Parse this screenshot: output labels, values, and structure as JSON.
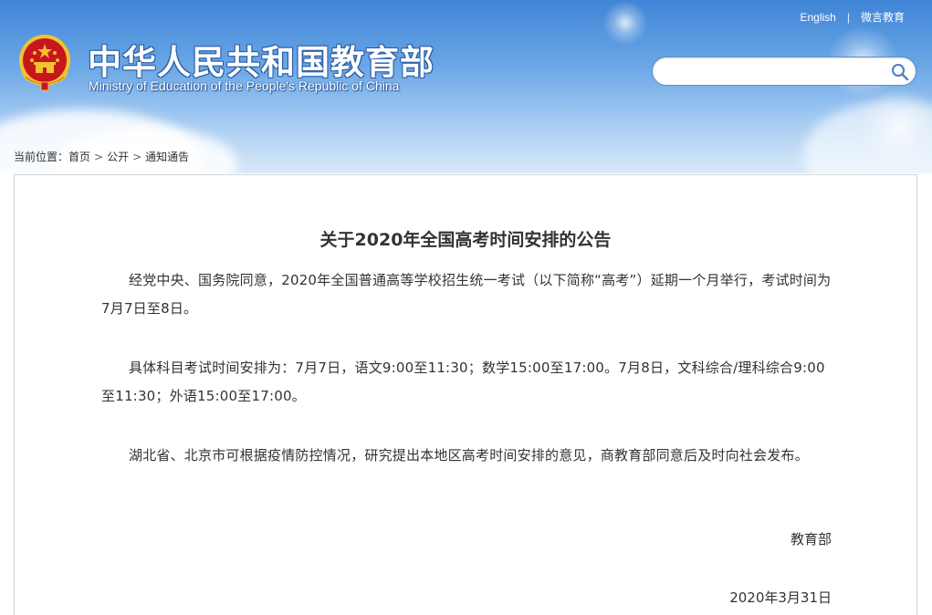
{
  "header": {
    "title": "中华人民共和国教育部",
    "subtitle": "Ministry of Education of the People's Republic of China",
    "links": [
      {
        "label": "English"
      },
      {
        "label": "微言教育"
      }
    ],
    "link_separator": "|",
    "search": {
      "value": "",
      "placeholder": ""
    }
  },
  "breadcrumb": {
    "prefix": "当前位置：",
    "items": [
      "首页",
      "公开",
      "通知通告"
    ],
    "separator": ">"
  },
  "article": {
    "title": "关于2020年全国高考时间安排的公告",
    "paragraphs": [
      "经党中央、国务院同意，2020年全国普通高等学校招生统一考试（以下简称“高考”）延期一个月举行，考试时间为7月7日至8日。",
      "具体科目考试时间安排为：7月7日，语文9:00至11:30；数学15:00至17:00。7月8日，文科综合/理科综合9:00至11:30；外语15:00至17:00。",
      "湖北省、北京市可根据疫情防控情况，研究提出本地区高考时间安排的意见，商教育部同意后及时向社会发布。"
    ],
    "signature": "教育部",
    "date": "2020年3月31日"
  },
  "icons": {
    "emblem": "national-emblem-icon",
    "search": "search-icon",
    "crumb_separator": "chevron-right-icon"
  },
  "colors": {
    "header_top": "#3f84d6",
    "header_bottom": "#d8e9f9",
    "title_outline": "#2a5ea8",
    "text": "#333333",
    "border": "#d4d4d4",
    "emblem_red": "#c8161d",
    "emblem_gold": "#f2c230"
  }
}
